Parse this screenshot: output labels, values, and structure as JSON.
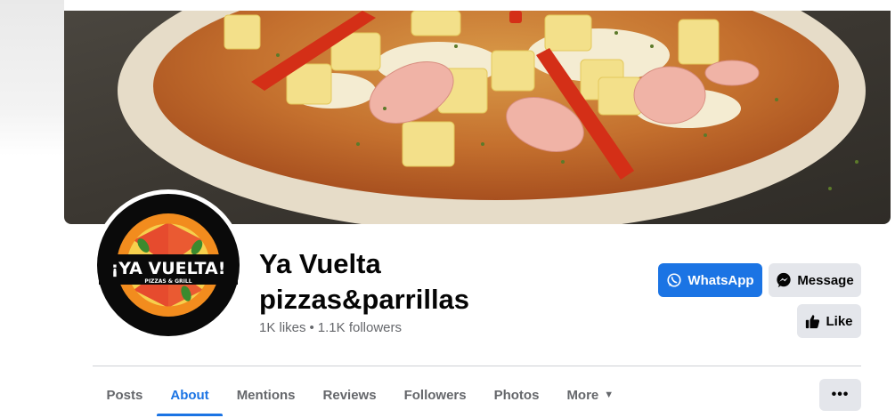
{
  "page": {
    "name_line1": "Ya Vuelta",
    "name_line2": "pizzas&parrillas",
    "likes": "1K likes",
    "separator": "•",
    "followers": "1.1K followers"
  },
  "logo": {
    "title": "¡YA VUELTA!",
    "subtitle": "PIZZAS & GRILL"
  },
  "actions": {
    "whatsapp": "WhatsApp",
    "message": "Message",
    "like": "Like",
    "more": "•••"
  },
  "tabs": [
    {
      "label": "Posts"
    },
    {
      "label": "About"
    },
    {
      "label": "Mentions"
    },
    {
      "label": "Reviews"
    },
    {
      "label": "Followers"
    },
    {
      "label": "Photos"
    },
    {
      "label": "More"
    }
  ],
  "colors": {
    "accent": "#1b74e4",
    "button_gray": "#e4e6eb",
    "secondary_text": "#65676b"
  },
  "icons": {
    "whatsapp": "whatsapp-icon",
    "message": "messenger-icon",
    "like": "thumbs-up-icon",
    "more_tab": "caret-down-icon"
  }
}
